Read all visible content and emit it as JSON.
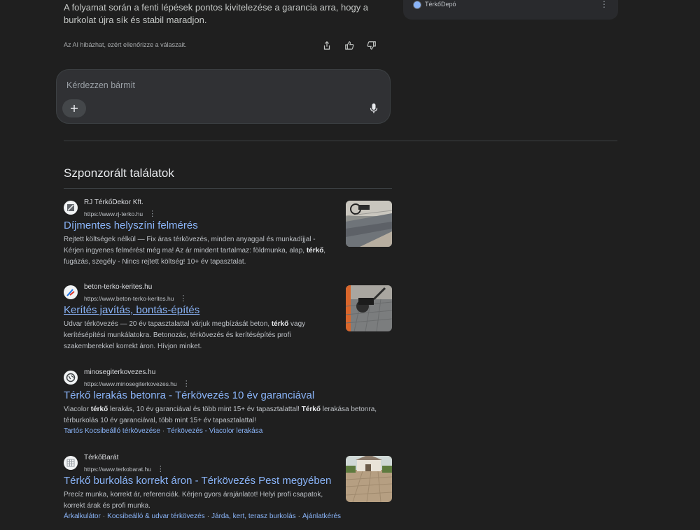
{
  "ai_answer": {
    "text": "A folyamat során a fenti lépések pontos kivitelezése a garancia arra, hogy a burkolat újra sík és stabil maradjon.",
    "disclaimer": "Az AI hibázhat, ezért ellenőrizze a válaszait."
  },
  "ask_box": {
    "placeholder": "Kérdezzen bármit"
  },
  "side_card": {
    "label": "TérkőDepó"
  },
  "sponsored": {
    "title": "Szponzorált találatok",
    "ads": [
      {
        "name": "RJ TérkőDekor Kft.",
        "url": "https://www.rj-terko.hu",
        "title": "Díjmentes helyszíni felmérés",
        "desc_parts": [
          "Rejtett költségek nélkül — Fix áras térkövezés, minden anyaggal és munkadíjjal - Kérjen ingyenes felmérést még ma! Az ár mindent tartalmaz: földmunka, alap, ",
          "térkő",
          ", fugázás, szegély - Nincs rejtett költség! 10+ év tapasztalat."
        ]
      },
      {
        "name": "beton-terko-kerites.hu",
        "url": "https://www.beton-terko-kerites.hu",
        "title": "Kerítés javítás, bontás-építés",
        "desc_parts": [
          "Udvar térkövezés — 20 év tapasztalattal várjuk megbízását beton, ",
          "térkő",
          " vagy kerítésépítési munkálatokra. Betonozás, térkövezés és kerítésépítés profi szakemberekkel korrekt áron. Hívjon minket."
        ]
      },
      {
        "name": "minosegiterkovezes.hu",
        "url": "https://www.minosegiterkovezes.hu",
        "title": "Térkő lerakás betonra - Térkövezés 10 év garanciával",
        "desc_parts": [
          "Viacolor ",
          "térkő",
          " lerakás, 10 év garanciával és több mint 15+ év tapasztalattal! ",
          "Térkő",
          " lerakása betonra, térburkolás 10 év garanciával, több mint 15+ év tapasztalattal!"
        ],
        "links": [
          "Tartós Kocsibeálló térkövezése",
          "Térkövezés - Viacolor lerakása"
        ]
      },
      {
        "name": "TérkőBarát",
        "url": "https://www.terkobarat.hu",
        "title": "Térkő burkolás korrekt áron - Térkövezés Pest megyében",
        "desc_parts": [
          "Precíz munka, korrekt ár, referenciák. Kérjen gyors árajánlatot! Helyi profi csapatok, korrekt árak és profi munka."
        ],
        "links": [
          "Árkalkulátor",
          "Kocsibeálló & udvar térkövezés",
          "Járda, kert, terasz burkolás",
          "Ajánlatkérés"
        ]
      }
    ]
  }
}
